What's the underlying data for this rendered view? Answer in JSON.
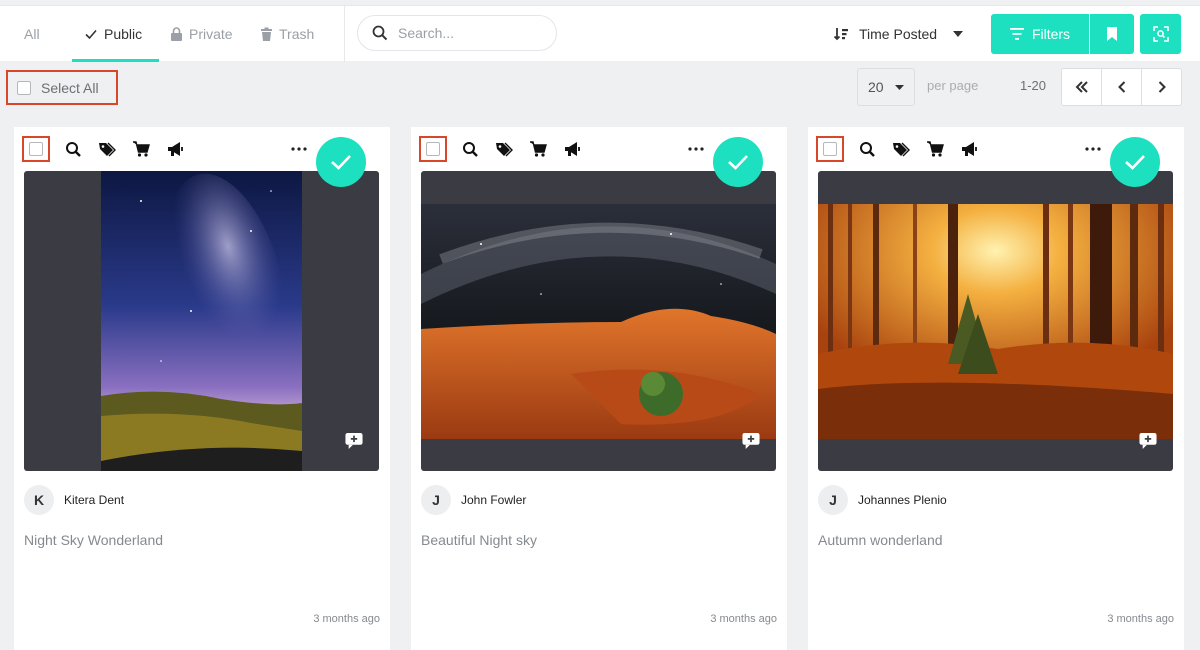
{
  "tabs": [
    {
      "label": "All",
      "icon": null
    },
    {
      "label": "Public",
      "icon": "check-icon"
    },
    {
      "label": "Private",
      "icon": "lock-icon"
    },
    {
      "label": "Trash",
      "icon": "trash-icon"
    }
  ],
  "active_tab": "Public",
  "search": {
    "placeholder": "Search..."
  },
  "sort": {
    "label": "Time Posted"
  },
  "filters": {
    "label": "Filters"
  },
  "toolbar": {
    "select_all": "Select All",
    "per_page_value": "20",
    "per_page_label": "per page",
    "range": "1-20"
  },
  "colors": {
    "accent": "#1de0c0",
    "highlight": "#d9472a"
  },
  "posts": [
    {
      "author": "Kitera Dent",
      "initial": "K",
      "title": "Night Sky Wonderland",
      "time": "3 months ago"
    },
    {
      "author": "John Fowler",
      "initial": "J",
      "title": "Beautiful Night sky",
      "time": "3 months ago"
    },
    {
      "author": "Johannes Plenio",
      "initial": "J",
      "title": "Autumn wonderland",
      "time": "3 months ago"
    }
  ]
}
